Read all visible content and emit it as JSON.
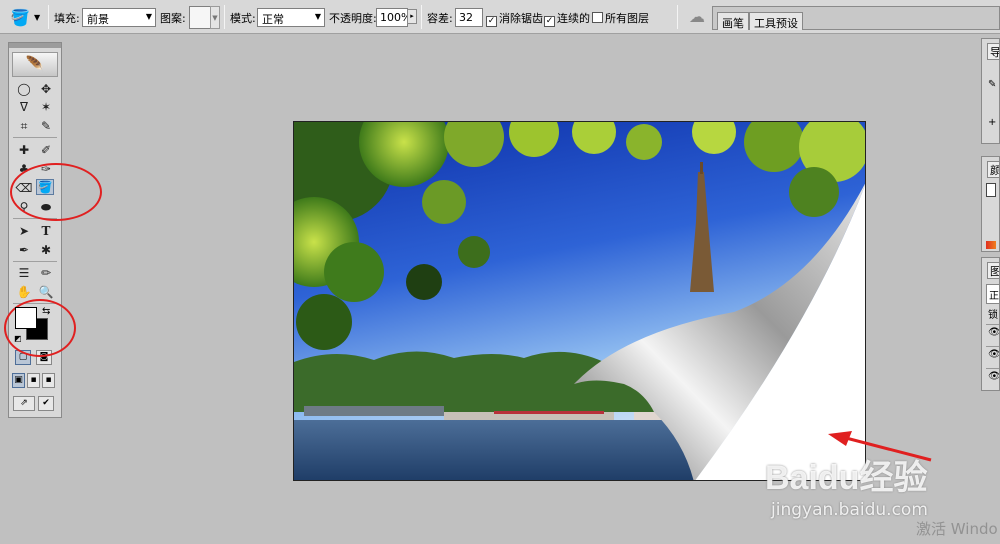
{
  "options_bar": {
    "fill_label": "填充:",
    "fill_value": "前景",
    "pattern_label": "图案:",
    "mode_label": "模式:",
    "mode_value": "正常",
    "opacity_label": "不透明度:",
    "opacity_value": "100%",
    "tolerance_label": "容差:",
    "tolerance_value": "32",
    "anti_alias_label": "消除锯齿",
    "anti_alias_checked": true,
    "contiguous_label": "连续的",
    "contiguous_checked": true,
    "all_layers_label": "所有图层",
    "all_layers_checked": false
  },
  "palette_well": {
    "tabs": [
      "画笔",
      "工具预设"
    ]
  },
  "toolbox": {
    "active_tool": "paint-bucket-tool",
    "foreground_color": "#ffffff",
    "background_color": "#000000"
  },
  "right_panels": {
    "panel_1_tab": "导",
    "panel_2_tab": "颜",
    "panel_3_tab": "图",
    "panel_3_blend": "正",
    "panel_3_lock": "锁"
  },
  "watermark": {
    "brand": "Baidu经验",
    "url": "jingyan.baidu.com"
  },
  "os_notice": "激活 Windo",
  "colors": {
    "annotation": "#e02020",
    "sky": "#1b3fb8",
    "page_curl": "#ffffff"
  }
}
